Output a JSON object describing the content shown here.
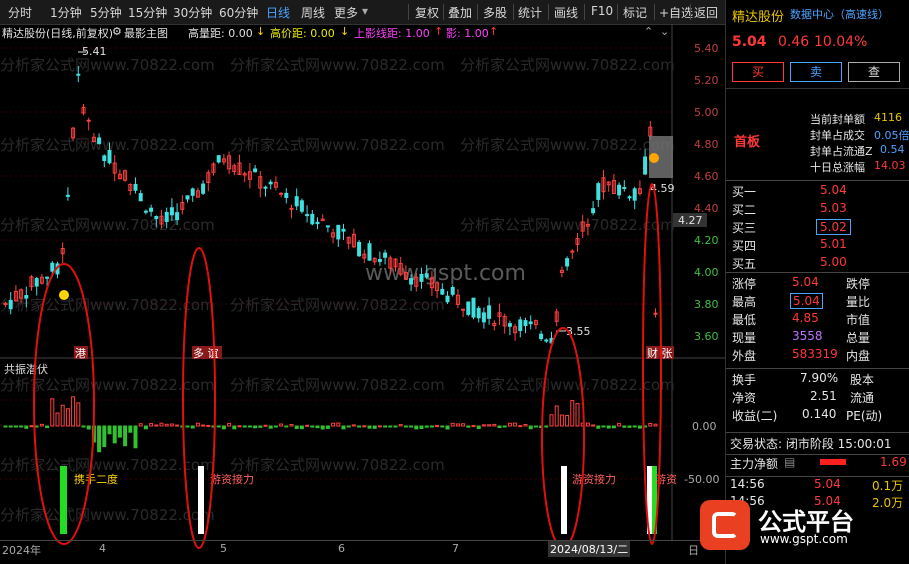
{
  "toolbar": {
    "left_items": [
      "分时",
      "1分钟",
      "5分钟",
      "15分钟",
      "30分钟",
      "60分钟",
      "日线",
      "周线",
      "更多"
    ],
    "right_items": [
      "复权",
      "叠加",
      "多股",
      "统计",
      "画线",
      "F10",
      "标记",
      "+自选",
      "返回"
    ],
    "active": "日线"
  },
  "chart_title": {
    "name": "精达股份(日线,前复权)",
    "indicator": "最影主图",
    "gaoliang": "高量距: 0.00",
    "gaojia": "高价距: 0.00",
    "shangying": "上影线距: 1.00",
    "ying": "影: 1.00"
  },
  "price_axis": [
    "5.40",
    "5.20",
    "5.00",
    "4.80",
    "4.60",
    "4.40",
    "4.20",
    "4.00",
    "3.80",
    "3.60"
  ],
  "price_current": "4.27",
  "annotations": {
    "high": "5.41",
    "low": "3.55",
    "last": "4.59",
    "tag1": "港",
    "tag2": "多 谊",
    "tag3": "财 张",
    "sub_title": "共振潜伏",
    "label1": "携手二度",
    "label2": "游资接力",
    "label3": "游资接力",
    "label4": "游资"
  },
  "sub_axis": [
    "0.00",
    "-50.00"
  ],
  "date_axis": {
    "y2024": "2024年",
    "m4": "4",
    "m5": "5",
    "m6": "6",
    "m7": "7",
    "date": "2024/08/13/二",
    "d": "日"
  },
  "watermark": "www.gspt.com",
  "watermark_small": "分析家公式网www.70822.com",
  "stock": {
    "name": "精达股份",
    "center": "数据中心（高速线）",
    "price": "5.04",
    "change": "0.46",
    "pct": "10.04%",
    "buy": "买",
    "sell": "卖",
    "query": "查"
  },
  "seal": {
    "label": "首板",
    "rows": [
      {
        "k": "当前封单额",
        "v": "4116"
      },
      {
        "k": "封单占成交",
        "v": "0.05倍"
      },
      {
        "k": "封单占流通Z",
        "v": "0.54"
      },
      {
        "k": "十日总涨幅",
        "v": "14.03"
      }
    ]
  },
  "bids": [
    {
      "k": "买一",
      "v": "5.04"
    },
    {
      "k": "买二",
      "v": "5.03"
    },
    {
      "k": "买三",
      "v": "5.02"
    },
    {
      "k": "买四",
      "v": "5.01"
    },
    {
      "k": "买五",
      "v": "5.00"
    }
  ],
  "quote": [
    {
      "k": "涨停",
      "v": "5.04",
      "k2": "跌停"
    },
    {
      "k": "最高",
      "v": "5.04",
      "k2": "量比"
    },
    {
      "k": "最低",
      "v": "4.85",
      "k2": "市值"
    },
    {
      "k": "现量",
      "v": "3558",
      "k2": "总量"
    },
    {
      "k": "外盘",
      "v": "583319",
      "k2": "内盘"
    }
  ],
  "stats": [
    {
      "k": "换手",
      "v": "7.90%",
      "k2": "股本"
    },
    {
      "k": "净资",
      "v": "2.51",
      "k2": "流通"
    },
    {
      "k": "收益(二)",
      "v": "0.140",
      "k2": "PE(动)"
    }
  ],
  "trade_state": "交易状态: 闭市阶段 15:00:01",
  "main_flow": {
    "label": "主力净额",
    "value": "1.69"
  },
  "ticks": [
    {
      "t": "14:56",
      "p": "5.04",
      "v": "0.1万"
    },
    {
      "t": "14:56",
      "p": "5.04",
      "v": "2.0万"
    }
  ],
  "logo": {
    "text": "公式平台",
    "url": "www.gspt.com"
  }
}
